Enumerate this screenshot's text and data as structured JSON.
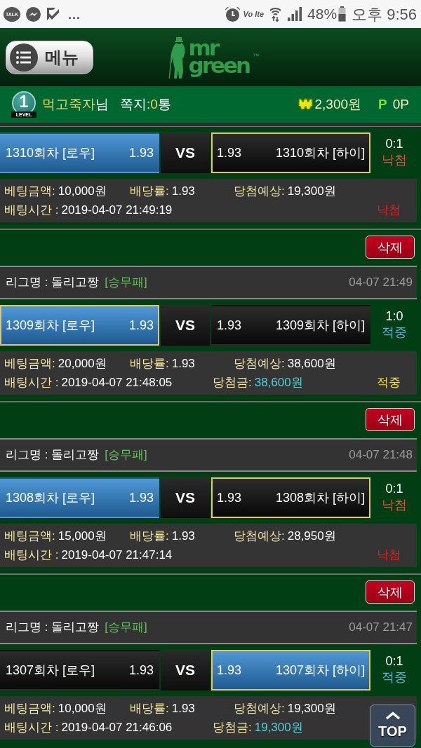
{
  "status_bar": {
    "notifications": [
      {
        "kind": "talk",
        "text": "TALK"
      },
      {
        "kind": "messenger"
      },
      {
        "kind": "check"
      }
    ],
    "overflow": "...",
    "network_label": "Vo lte",
    "battery_percent": "48%",
    "time": "오후 9:56"
  },
  "header": {
    "menu_button": "메뉴",
    "logo": {
      "text": "mr green",
      "trademark": "™"
    }
  },
  "user_bar": {
    "level": {
      "number": "1",
      "caption": "LEVEL"
    },
    "nickname": "먹고죽자",
    "honorific": "님",
    "messages_label": "쪽지:",
    "messages_count": "0",
    "messages_unit": "통",
    "currency_symbol": "₩",
    "balance": "2,300원",
    "points_symbol": "P",
    "points": "0P"
  },
  "bets": [
    {
      "kind": "lost",
      "options": [
        {
          "label": "1310회차 [로우]",
          "odds": "1.93",
          "highlighted": true,
          "selected": false
        },
        {
          "label": "1310회차 [하이]",
          "odds": "1.93",
          "highlighted": false,
          "selected": true
        }
      ],
      "vs": "VS",
      "score": "0:1",
      "result": "낙첨",
      "info": {
        "amount_label": "베팅금액:",
        "amount": "10,000원",
        "odds_label": "배당률:",
        "odds": "1.93",
        "expected_label": "당첨예상:",
        "expected": "19,300원",
        "time_label": "배팅시간 :",
        "time": "2019-04-07 21:49:19",
        "result": "낙첨"
      }
    },
    {
      "kind": "won",
      "delete_button": "삭제",
      "league": {
        "label": "리그명 : 돌리고짱",
        "type": "[승무패]",
        "time": "04-07 21:49"
      },
      "options": [
        {
          "label": "1309회차 [로우]",
          "odds": "1.93",
          "highlighted": true,
          "selected": true
        },
        {
          "label": "1309회차 [하이]",
          "odds": "1.93",
          "highlighted": false,
          "selected": false
        }
      ],
      "vs": "VS",
      "score": "1:0",
      "result": "적중",
      "info": {
        "amount_label": "베팅금액:",
        "amount": "20,000원",
        "odds_label": "배당률:",
        "odds": "1.93",
        "expected_label": "당첨예상:",
        "expected": "38,600원",
        "time_label": "배팅시간 :",
        "time": "2019-04-07 21:48:05",
        "payout_label": "당첨금:",
        "payout": "38,600원",
        "result": "적중"
      }
    },
    {
      "kind": "lost",
      "delete_button": "삭제",
      "league": {
        "label": "리그명 : 돌리고짱",
        "type": "[승무패]",
        "time": "04-07 21:48"
      },
      "options": [
        {
          "label": "1308회차 [로우]",
          "odds": "1.93",
          "highlighted": true,
          "selected": false
        },
        {
          "label": "1308회차 [하이]",
          "odds": "1.93",
          "highlighted": false,
          "selected": true
        }
      ],
      "vs": "VS",
      "score": "0:1",
      "result": "낙첨",
      "info": {
        "amount_label": "베팅금액:",
        "amount": "15,000원",
        "odds_label": "배당률:",
        "odds": "1.93",
        "expected_label": "당첨예상:",
        "expected": "28,950원",
        "time_label": "배팅시간 :",
        "time": "2019-04-07 21:47:14",
        "result": "낙첨"
      }
    },
    {
      "kind": "won",
      "delete_button": "삭제",
      "league": {
        "label": "리그명 : 돌리고짱",
        "type": "[승무패]",
        "time": "04-07 21:47"
      },
      "options": [
        {
          "label": "1307회차 [로우]",
          "odds": "1.93",
          "highlighted": false,
          "selected": false
        },
        {
          "label": "1307회차 [하이]",
          "odds": "1.93",
          "highlighted": true,
          "selected": true
        }
      ],
      "vs": "VS",
      "score": "0:1",
      "result": "적중",
      "info": {
        "amount_label": "베팅금액:",
        "amount": "10,000원",
        "odds_label": "배당률:",
        "odds": "1.93",
        "expected_label": "당첨예상:",
        "expected": "19,300원",
        "time_label": "배팅시간 :",
        "time": "2019-04-07 21:46:06",
        "payout_label": "당첨금:",
        "payout": "19,300원"
      }
    }
  ],
  "top_button": "TOP"
}
